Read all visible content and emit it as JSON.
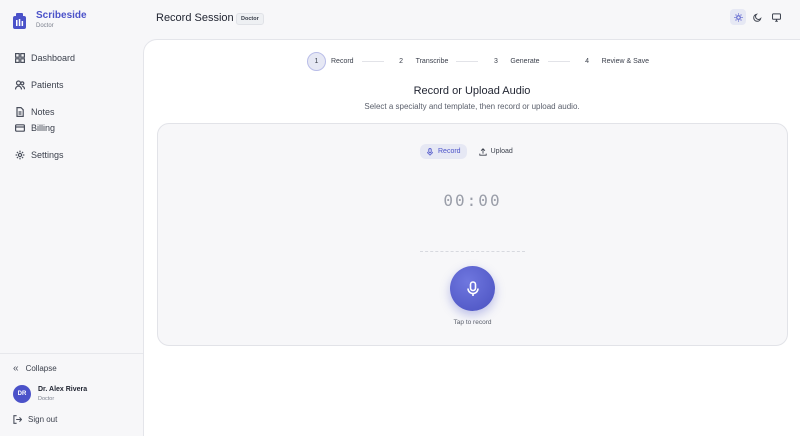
{
  "brand": {
    "name": "Scribeside",
    "role": "Doctor"
  },
  "sidebar": {
    "items": [
      {
        "label": "Dashboard",
        "icon": "grid-icon"
      },
      {
        "label": "Patients",
        "icon": "users-icon"
      },
      {
        "label": "Notes",
        "icon": "file-icon"
      },
      {
        "label": "Billing",
        "icon": "card-icon"
      },
      {
        "label": "Settings",
        "icon": "gear-icon"
      }
    ],
    "collapse_label": "Collapse",
    "user": {
      "initials": "DR",
      "name": "Dr. Alex Rivera",
      "role": "Doctor"
    },
    "signout_label": "Sign out"
  },
  "header": {
    "title": "Record Session",
    "badge": "Doctor",
    "theme_options": [
      "sun-icon",
      "moon-icon",
      "monitor-icon"
    ],
    "active_theme": "sun-icon"
  },
  "stepper": {
    "steps": [
      {
        "num": "1",
        "label": "Record",
        "active": true
      },
      {
        "num": "2",
        "label": "Transcribe",
        "active": false
      },
      {
        "num": "3",
        "label": "Generate",
        "active": false
      },
      {
        "num": "4",
        "label": "Review & Save",
        "active": false
      }
    ]
  },
  "main": {
    "heading": "Record or Upload Audio",
    "subheading": "Select a specialty and template, then record or upload audio.",
    "modes": {
      "record": "Record",
      "upload": "Upload",
      "active": "record"
    },
    "timer": "00:00",
    "mic_caption": "Tap to record"
  },
  "colors": {
    "accent": "#4b52c9",
    "background": "#f7f7f9",
    "panel": "#ffffff"
  }
}
